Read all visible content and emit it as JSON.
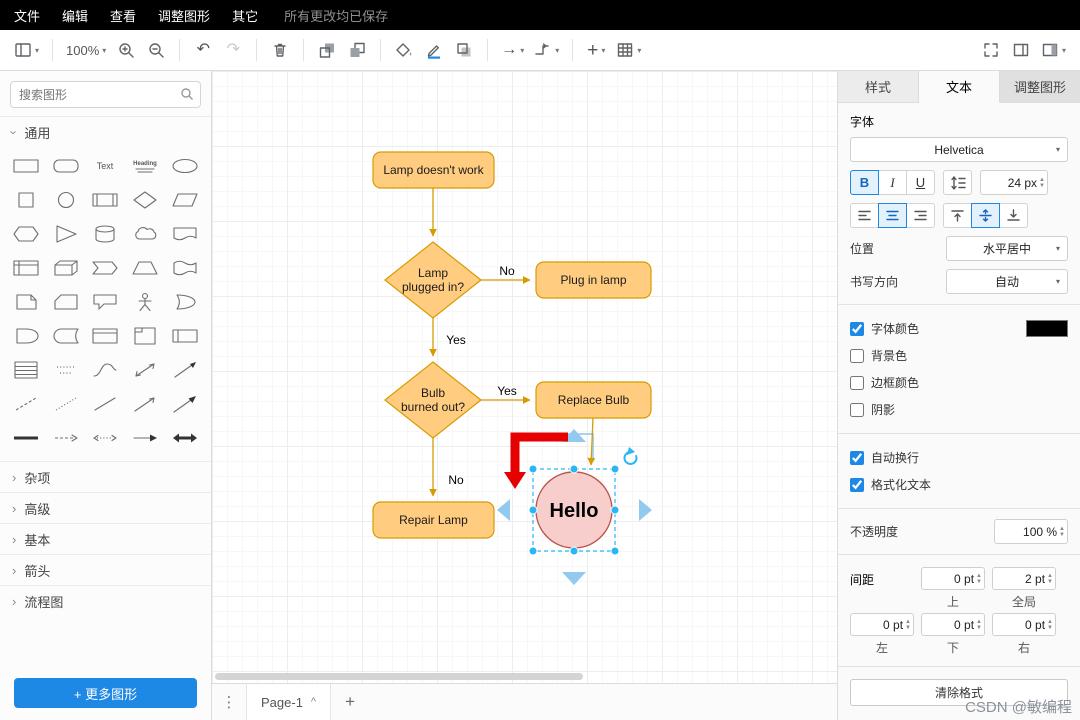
{
  "icons": {
    "caret": "▾",
    "chevron": "›",
    "kebab": "⋮",
    "plus": "+",
    "arrow_right": "→",
    "undo": "↶",
    "redo": "↷",
    "page_caret": "^",
    "stepper_up": "▲",
    "stepper_down": "▼"
  },
  "colors": {
    "accent": "#1e88e5",
    "flow_shape_fill": "#ffcc80",
    "flow_shape_stroke": "#d79b00",
    "circle_fill": "#f8cecc",
    "circle_stroke": "#b85450",
    "selection": "#29b6f2",
    "red_arrow": "#e60000",
    "font_color_swatch": "#000000"
  },
  "menubar": {
    "items": [
      "文件",
      "编辑",
      "查看",
      "调整图形",
      "其它"
    ],
    "status": "所有更改均已保存"
  },
  "toolbar": {
    "zoom_value": "100%"
  },
  "sidebar": {
    "search_placeholder": "搜索图形",
    "section_general": "通用",
    "shape_text_label": "Text",
    "shape_heading_label": "Heading",
    "sections_collapsed": [
      "杂项",
      "高级",
      "基本",
      "箭头",
      "流程图"
    ],
    "more_shapes_label": "+ 更多图形"
  },
  "canvas": {
    "nodes": {
      "start": "Lamp doesn't work",
      "q1_line1": "Lamp",
      "q1_line2": "plugged in?",
      "plug": "Plug in lamp",
      "q2_line1": "Bulb",
      "q2_line2": "burned out?",
      "replace": "Replace Bulb",
      "repair": "Repair Lamp",
      "hello": "Hello"
    },
    "edge_labels": {
      "no1": "No",
      "yes1": "Yes",
      "yes2": "Yes",
      "no2": "No"
    }
  },
  "footer": {
    "page_tab": "Page-1"
  },
  "panel": {
    "tabs": [
      "样式",
      "文本",
      "调整图形"
    ],
    "font_label": "字体",
    "font_family": "Helvetica",
    "bold": "B",
    "italic": "I",
    "underline": "U",
    "font_size": "24 px",
    "position_label": "位置",
    "position_value": "水平居中",
    "direction_label": "书写方向",
    "direction_value": "自动",
    "font_color_label": "字体颜色",
    "background_label": "背景色",
    "border_color_label": "边框颜色",
    "shadow_label": "阴影",
    "word_wrap_label": "自动换行",
    "formatted_text_label": "格式化文本",
    "opacity_label": "不透明度",
    "opacity_value": "100 %",
    "spacing_label": "间距",
    "spacing_top": "0 pt",
    "spacing_top_label": "上",
    "spacing_global": "2 pt",
    "spacing_global_label": "全局",
    "spacing_left": "0 pt",
    "spacing_left_label": "左",
    "spacing_bottom": "0 pt",
    "spacing_bottom_label": "下",
    "spacing_right": "0 pt",
    "spacing_right_label": "右",
    "clear_format_label": "清除格式"
  },
  "watermark": "CSDN @敏编程"
}
